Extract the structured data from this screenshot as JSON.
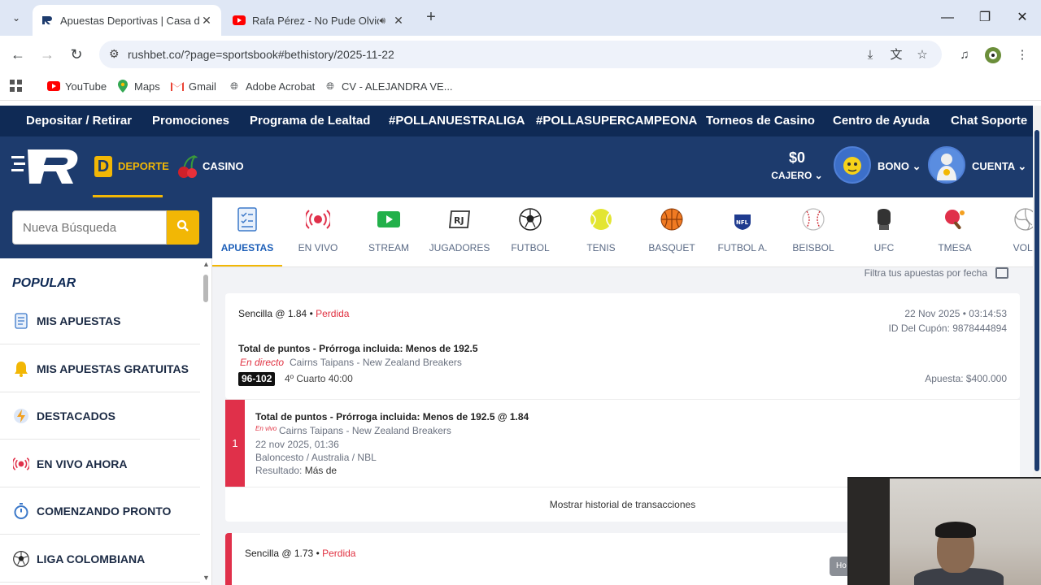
{
  "browser": {
    "tabs": [
      {
        "title": "Apuestas Deportivas | Casa de Apuestas",
        "active": true
      },
      {
        "title": "Rafa Pérez - No Pude Olvidarte",
        "active": false,
        "audio": true
      }
    ],
    "new_tab": "+",
    "url": "rushbet.co/?page=sportsbook#bethistory/2025-11-22",
    "bookmarks": [
      {
        "label": "YouTube",
        "icon": "youtube-icon"
      },
      {
        "label": "Maps",
        "icon": "maps-icon"
      },
      {
        "label": "Gmail",
        "icon": "gmail-icon"
      },
      {
        "label": "Adobe Acrobat",
        "icon": "globe-icon"
      },
      {
        "label": "CV - ALEJANDRA VE...",
        "icon": "globe-icon"
      }
    ]
  },
  "topnav": [
    "Depositar / Retirar",
    "Promociones",
    "Programa de Lealtad",
    "#POLLANUESTRALIGA",
    "#POLLASUPERCAMPEONA",
    "Torneos de Casino",
    "Centro de Ayuda",
    "Chat Soporte"
  ],
  "header": {
    "deporte": "DEPORTE",
    "deporte_letter": "D",
    "casino": "CASINO",
    "balance": "$0",
    "cajero": "CAJERO",
    "bono": "BONO",
    "cuenta": "CUENTA"
  },
  "search": {
    "placeholder": "Nueva Búsqueda"
  },
  "sports": [
    {
      "label": "APUESTAS",
      "icon": "betslip-icon",
      "active": true
    },
    {
      "label": "EN VIVO",
      "icon": "live-icon"
    },
    {
      "label": "STREAM",
      "icon": "stream-icon"
    },
    {
      "label": "JUGADORES",
      "icon": "players-icon"
    },
    {
      "label": "FUTBOL",
      "icon": "soccer-ball-icon"
    },
    {
      "label": "TENIS",
      "icon": "tennis-ball-icon"
    },
    {
      "label": "BASQUET",
      "icon": "basketball-icon"
    },
    {
      "label": "FUTBOL A.",
      "icon": "nfl-icon"
    },
    {
      "label": "BEISBOL",
      "icon": "baseball-icon"
    },
    {
      "label": "UFC",
      "icon": "glove-icon"
    },
    {
      "label": "TMESA",
      "icon": "table-tennis-icon"
    },
    {
      "label": "VOLL",
      "icon": "volleyball-icon"
    }
  ],
  "sidebar": {
    "heading": "POPULAR",
    "items": [
      {
        "label": "MIS APUESTAS",
        "icon": "betslip-icon"
      },
      {
        "label": "MIS APUESTAS GRATUITAS",
        "icon": "bell-icon"
      },
      {
        "label": "DESTACADOS",
        "icon": "lightning-icon"
      },
      {
        "label": "EN VIVO AHORA",
        "icon": "live-icon"
      },
      {
        "label": "COMENZANDO PRONTO",
        "icon": "stopwatch-icon"
      },
      {
        "label": "LIGA COLOMBIANA",
        "icon": "soccer-ball-icon"
      }
    ]
  },
  "main": {
    "filter_label": "Filtra tus apuestas por fecha",
    "bet1": {
      "type": "Sencilla @ 1.84",
      "separator": " • ",
      "status": "Perdida",
      "date": "22 Nov 2025 • 03:14:53",
      "coupon": "ID Del Cupón: 9878444894",
      "market": "Total de puntos - Prórroga incluida: Menos de 192.5",
      "live": "En directo",
      "teams": "Cairns Taipans - New Zealand Breakers",
      "score": "96-102",
      "period": "4º Cuarto 40:00",
      "stake": "Apuesta: $400.000"
    },
    "leg1": {
      "number": "1",
      "title": "Total de puntos - Prórroga incluida: Menos de 192.5 @ 1.84",
      "live": "En vivo",
      "teams": "Cairns Taipans - New Zealand Breakers",
      "datetime": "22 nov 2025, 01:36",
      "league": "Baloncesto / Australia / NBL",
      "result_label": "Resultado:",
      "result_value": "Más de"
    },
    "history_link": "Mostrar historial de transacciones",
    "bet2": {
      "type": "Sencilla @ 1.73",
      "separator": " • ",
      "status": "Perdida"
    }
  },
  "overlay": {
    "tooltip": "Ho"
  },
  "colors": {
    "nav_dark": "#0f2a55",
    "header": "#1d3b6d",
    "accent": "#f2b705",
    "loss": "#e0304a"
  }
}
